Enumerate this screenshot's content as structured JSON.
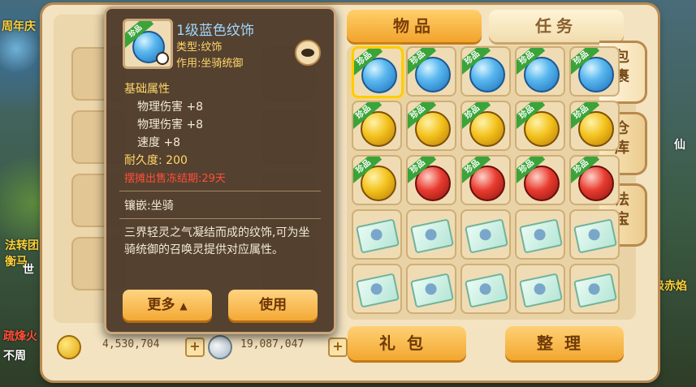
{
  "tabs": {
    "items": "物品",
    "tasks": "任务"
  },
  "side_tabs": [
    {
      "label": [
        "包",
        "裹"
      ]
    },
    {
      "label": [
        "仓",
        "库"
      ]
    },
    {
      "label": [
        "法",
        "宝"
      ]
    }
  ],
  "buttons": {
    "gift": "礼包",
    "sort": "整理",
    "more": "更多",
    "use": "使用"
  },
  "currency": {
    "gold": "4,530,704",
    "silver": "19,087,047"
  },
  "badge": "珍品",
  "item": {
    "title": "1级蓝色纹饰",
    "type": "类型:纹饰",
    "effect": "作用:坐骑统御",
    "base_attr_title": "基础属性",
    "attrs": [
      "物理伤害 +8",
      "物理伤害 +8",
      "速度 +8"
    ],
    "durability": "耐久度: 200",
    "red_notice": "摆摊出售冻结期:29天",
    "inlay": "镶嵌:坐骑",
    "description": "三界轻灵之气凝结而成的纹饰,可为坐骑统御的召唤灵提供对应属性。"
  },
  "bg": {
    "t1": "周年庆",
    "t2": "法转团",
    "t3": "衡马",
    "t4": "世",
    "t5": "疏烽火",
    "t6": "不周",
    "t7": "超级赤焰",
    "t8": "仙"
  },
  "colors": {
    "accent": "#f2a32c",
    "tooltip_bg": "#4e3a2a",
    "rare_badge": "#3aa43a"
  }
}
